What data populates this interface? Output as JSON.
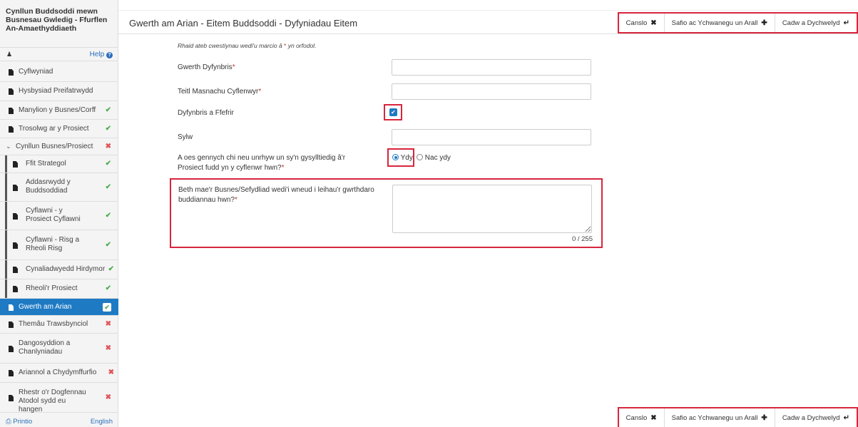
{
  "sidebar": {
    "title_lines": [
      "Cynllun Buddsoddi mewn",
      "Busnesau Gwledig - Ffurflen",
      "An-Amaethyddiaeth"
    ],
    "help_label": "Help",
    "items": [
      {
        "label": "Cyflwyniad",
        "status": ""
      },
      {
        "label": "Hysbysiad Preifatrwydd",
        "status": ""
      },
      {
        "label": "Manylion y Busnes/Corff",
        "status": "✔"
      },
      {
        "label": "Trosolwg ar y Prosiect",
        "status": "✔"
      },
      {
        "label": "Cynllun Busnes/Prosiect",
        "status": "✖"
      },
      {
        "label": "Ffit Strategol",
        "status": "✔"
      },
      {
        "label": "Addasrwydd y Buddsoddiad",
        "status": "✔"
      },
      {
        "label": "Cyflawni - y Prosiect Cyflawni",
        "status": "✔"
      },
      {
        "label": "Cyflawni - Risg a Rheoli Risg",
        "status": "✔"
      },
      {
        "label": "Cynaliadwyedd Hirdymor",
        "status": "✔"
      },
      {
        "label": "Rheoli'r Prosiect",
        "status": "✔"
      },
      {
        "label": "Gwerth am Arian",
        "status": "✔"
      },
      {
        "label": "Themâu Trawsbynciol",
        "status": "✖"
      },
      {
        "label": "Dangosyddion a Chanlyniadau",
        "status": "✖"
      },
      {
        "label": "Ariannol a Chydymffurfio",
        "status": "✖"
      },
      {
        "label": "Rhestr o'r Dogfennau Atodol sydd eu hangen",
        "status": "✖"
      }
    ],
    "print_label": "Printio",
    "english_label": "English"
  },
  "header": {
    "title": "Gwerth am Arian - Eitem Buddsoddi - Dyfyniadau Eitem"
  },
  "actions": {
    "cancel": "Canslo",
    "save_add": "Safio ac Ychwanegu un Arall",
    "save_return": "Cadw a Dychwelyd"
  },
  "form": {
    "required_note": "Rhaid ateb cwestiynau wedi'u marcio â",
    "required_note_tail": "yn orfodol.",
    "quote_value_label": "Gwerth Dyfynbris",
    "supplier_name_label": "Teitl Masnachu Cyflenwyr",
    "preferred_label": "Dyfynbris a Ffefrir",
    "preferred_checked": true,
    "comment_label": "Sylw",
    "connected_label": "A oes gennych chi neu unrhyw un sy'n gysylltiedig â'r Prosiect fudd yn y cyflenwr hwn?",
    "yes_label": "Ydy",
    "no_label": "Nac ydy",
    "mitigation_label": "Beth mae'r Busnes/Sefydliad wedi'i wneud i leihau'r gwrthdaro buddiannau hwn?",
    "counter": "0 / 255"
  },
  "colors": {
    "accent": "#1f7ac4",
    "ok": "#4caf50",
    "error": "#e0565b",
    "highlight": "#d7263d"
  }
}
